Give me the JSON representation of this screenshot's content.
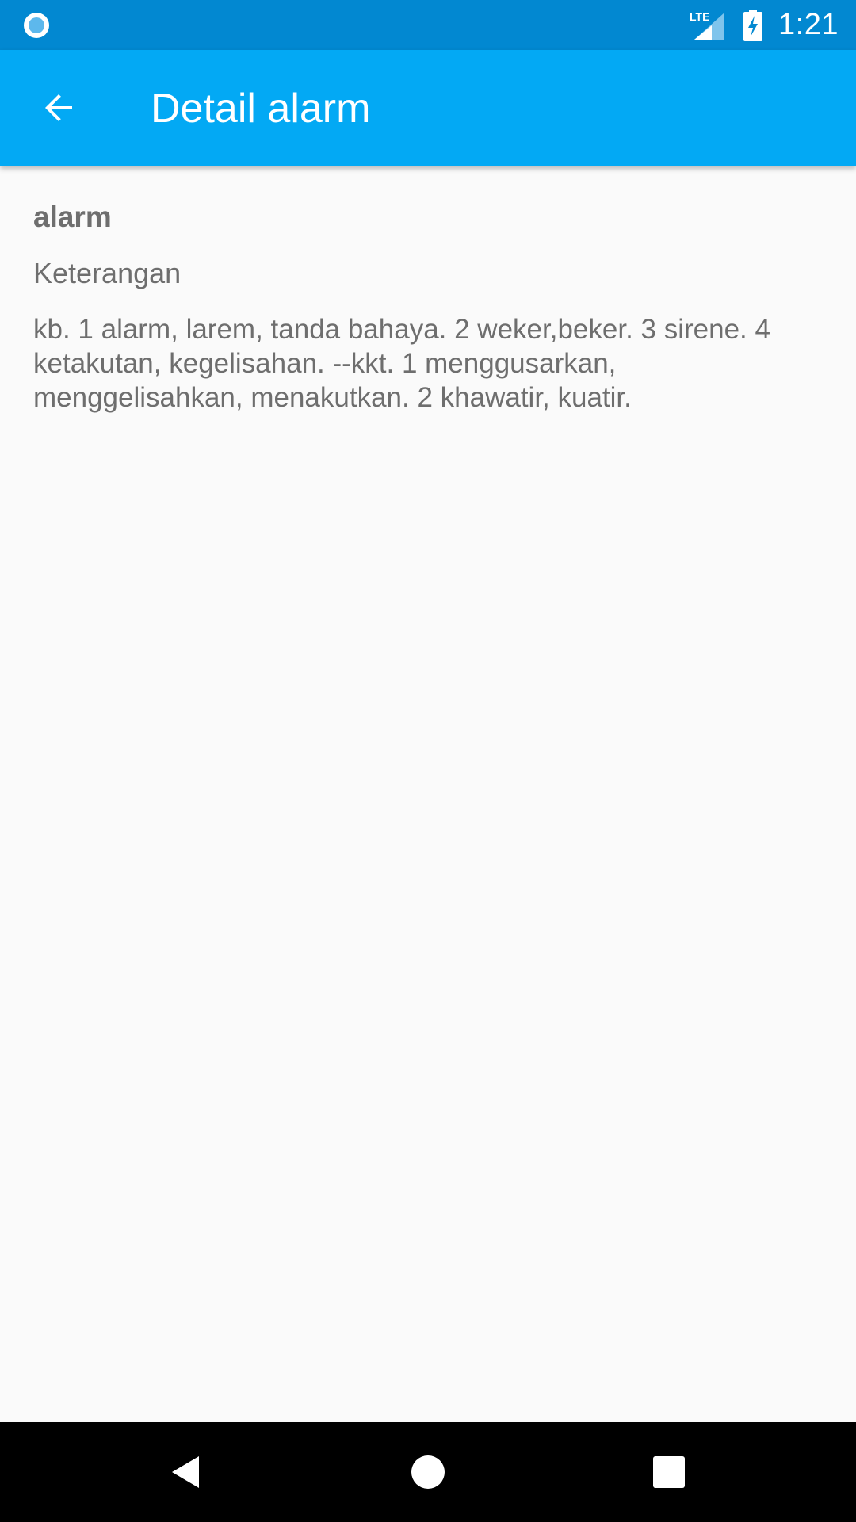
{
  "status_bar": {
    "time": "1:21",
    "network_label": "LTE",
    "left_icon": "notification-circle-icon",
    "color": "#0288D1"
  },
  "app_bar": {
    "title": "Detail alarm",
    "back_icon": "arrow-back-icon",
    "color": "#03A9F4"
  },
  "content": {
    "word": "alarm",
    "section_label": "Keterangan",
    "definition": "kb. 1 alarm, larem, tanda bahaya. 2 weker,beker. 3 sirene. 4 ketakutan, kegelisahan. --kkt. 1 menggusarkan, menggelisahkan, menakutkan. 2 khawatir, kuatir."
  },
  "nav_bar": {
    "back_icon": "nav-back-triangle-icon",
    "home_icon": "nav-home-circle-icon",
    "recents_icon": "nav-recents-square-icon"
  }
}
